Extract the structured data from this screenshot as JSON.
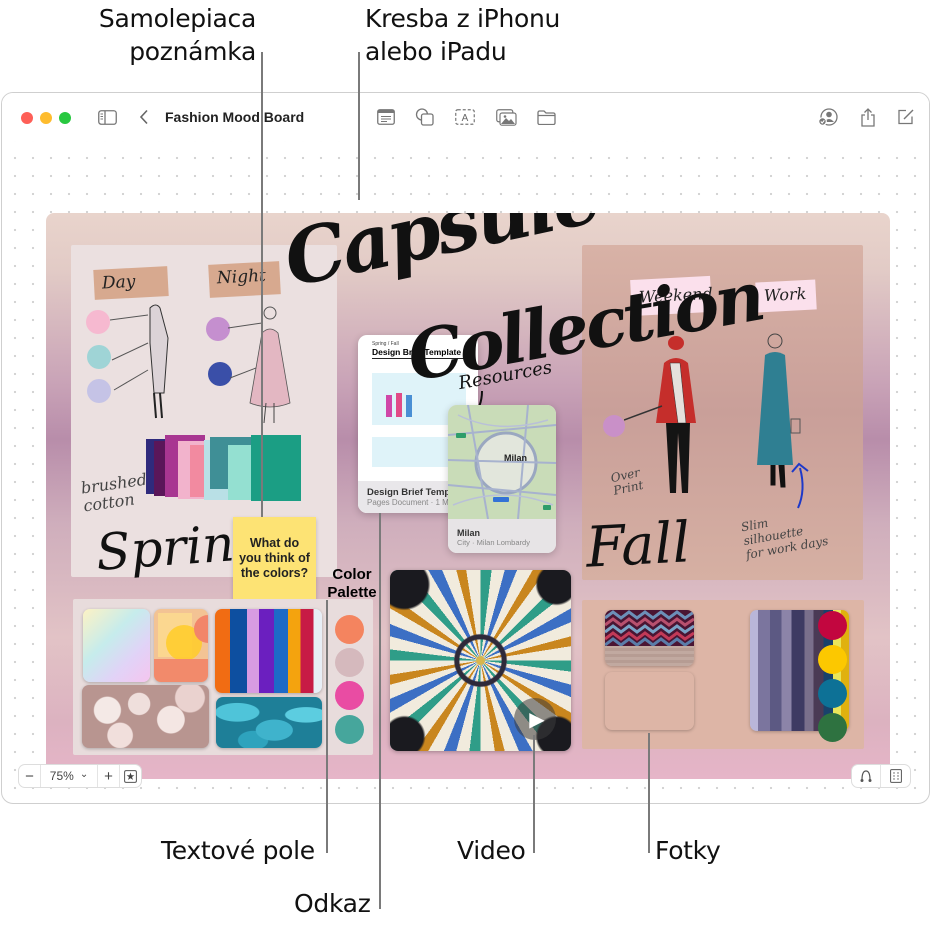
{
  "callouts": {
    "sticky_note": [
      "Samolepiaca",
      "poznámka"
    ],
    "drawing": [
      "Kresba z iPhonu",
      "alebo iPadu"
    ],
    "text_box": "Textové pole",
    "link": "Odkaz",
    "video": "Video",
    "photos": "Fotky"
  },
  "window": {
    "title": "Fashion Mood Board",
    "traffic_lights": {
      "close": "#fe5f57",
      "minimize": "#febc2e",
      "zoom": "#28c840"
    },
    "toolbar_icons": [
      "sidebar-icon",
      "back-chevron-icon",
      "note-icon",
      "shapes-icon",
      "text-box-icon",
      "media-icon",
      "folder-icon",
      "collaborate-icon",
      "share-icon",
      "compose-icon"
    ]
  },
  "board": {
    "heading_drawing": [
      "Capsule",
      "Collection"
    ],
    "spring": {
      "tags": [
        "Day",
        "Night"
      ],
      "annotation": [
        "brushed",
        "cotton"
      ],
      "season_label": "Spring",
      "day_swatches": [
        "#f6b9d0",
        "#9fd4d6",
        "#c5c3e6"
      ],
      "night_swatches": [
        "#c58fcf",
        "#3a4fa8"
      ],
      "fabric_colors": [
        "#2f2a7c",
        "#8a1d6a",
        "#a83691",
        "#f2b3cc",
        "#f28aa0",
        "#b9e0e6",
        "#3f8f96",
        "#94e0d1",
        "#1b9e84"
      ]
    },
    "sticky_note": {
      "text": "What do you think of the colors?",
      "color": "#fde374"
    },
    "color_palette_label": [
      "Color",
      "Palette"
    ],
    "spring_palette": [
      "#f4845f",
      "#d5b9bd",
      "#e94ca3",
      "#46a69c"
    ],
    "spring_photos": [
      "watercolor",
      "geometric-shapes",
      "fabric-rolls",
      "roses",
      "turquoise-stones"
    ],
    "document_card": {
      "subtitle": "Spring / Fall",
      "doc_title": "Design Brief Template",
      "name": "Design Brief Template",
      "meta": "Pages Document · 1 MB"
    },
    "resources_drawing": "Resources",
    "map_card": {
      "city_label": "Milan",
      "name": "Milan",
      "meta": "City · Milan Lombardy"
    },
    "video": {
      "label": "play-button",
      "play_icon": "▶"
    },
    "fall": {
      "tags": [
        "Weekend",
        "Work"
      ],
      "annotation_left": [
        "Over",
        "Print"
      ],
      "annotation_right": [
        "Slim",
        "silhouette",
        "for work days"
      ],
      "season_label": "Fall",
      "figure_colors": {
        "weekend_coat": "#c52e2b",
        "work_coat": "#2f7f92"
      }
    },
    "fall_palette": [
      "#c2063f",
      "#fcc800",
      "#0d7196",
      "#2e7240"
    ],
    "fall_photos": [
      "zigzag-knit",
      "woven-textile",
      "striped-fabric"
    ]
  },
  "zoom_control": {
    "minus": "−",
    "value": "75%",
    "plus": "+",
    "chevron": "⌄"
  }
}
